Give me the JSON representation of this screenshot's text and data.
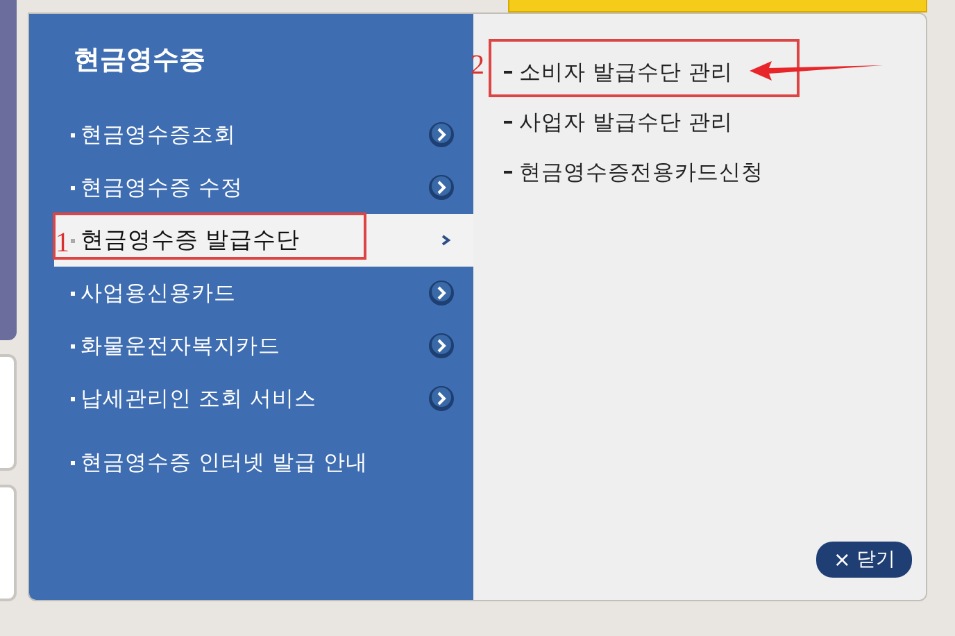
{
  "menu": {
    "title": "현금영수증",
    "items": [
      {
        "label": "현금영수증조회",
        "selected": false,
        "has_arrow": true
      },
      {
        "label": "현금영수증 수정",
        "selected": false,
        "has_arrow": true
      },
      {
        "label": "현금영수증 발급수단",
        "selected": true,
        "has_arrow": true
      },
      {
        "label": "사업용신용카드",
        "selected": false,
        "has_arrow": true
      },
      {
        "label": "화물운전자복지카드",
        "selected": false,
        "has_arrow": true
      },
      {
        "label": "납세관리인 조회 서비스",
        "selected": false,
        "has_arrow": true
      },
      {
        "label": "현금영수증 인터넷 발급 안내",
        "selected": false,
        "has_arrow": false
      }
    ]
  },
  "submenu": {
    "items": [
      {
        "label": "소비자 발급수단 관리"
      },
      {
        "label": "사업자 발급수단 관리"
      },
      {
        "label": "현금영수증전용카드신청"
      }
    ]
  },
  "close_button": {
    "symbol": "×",
    "label": "닫기"
  },
  "annotations": [
    {
      "number": "1"
    },
    {
      "number": "2"
    }
  ]
}
